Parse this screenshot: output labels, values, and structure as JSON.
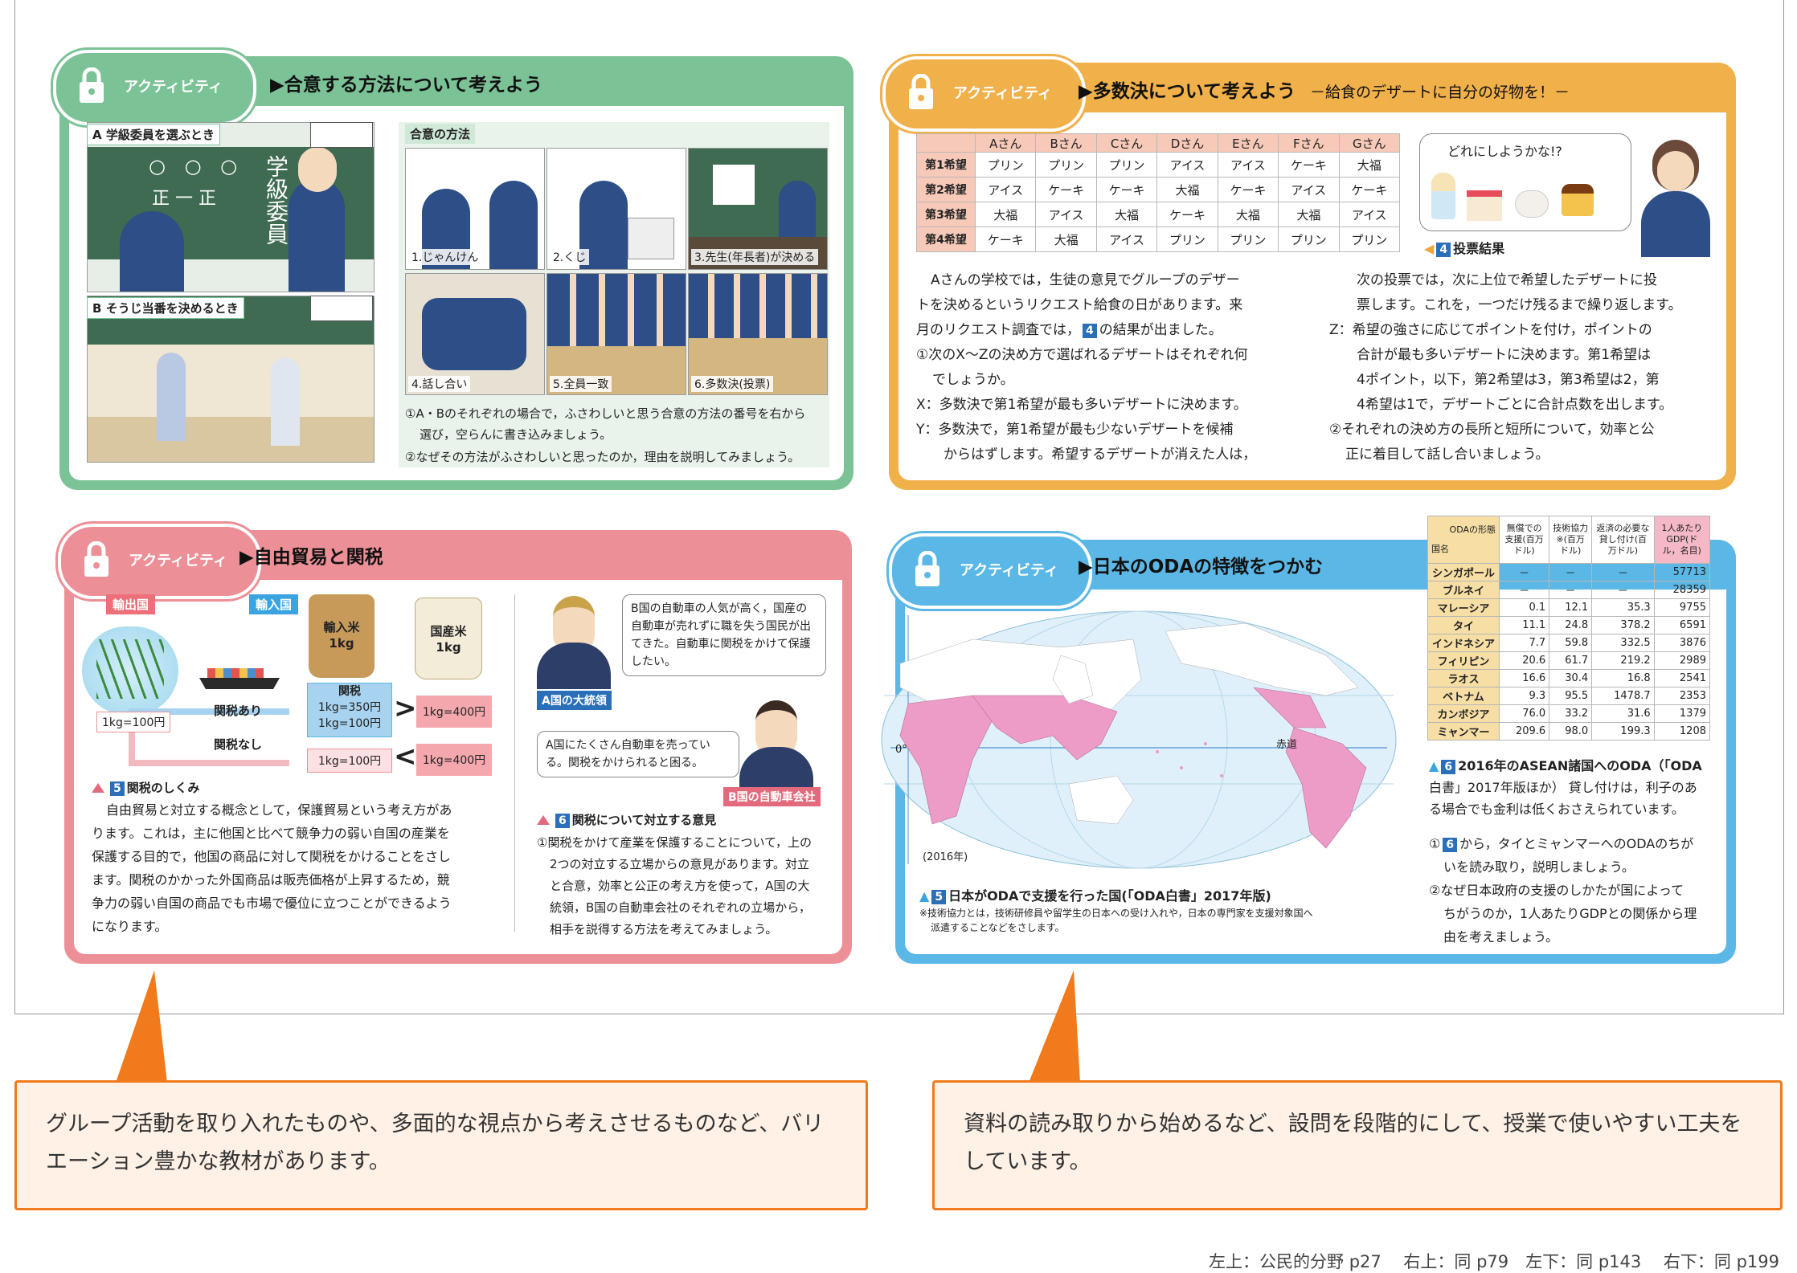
{
  "activity_label": "アクティビティ",
  "p1": {
    "title": "▶合意する方法について考えよう",
    "scene_a": "A 学級委員を選ぶとき",
    "scene_b": "B そうじ当番を決めるとき",
    "methods_label": "合意の方法",
    "board_text": "学級委員",
    "board_marks": "○ ○ ○",
    "board_tally": "正 一   正",
    "methods": [
      "1.じゃんけん",
      "2.くじ",
      "3.先生(年長者)が決める",
      "4.話し合い",
      "5.全員一致",
      "6.多数決(投票)"
    ],
    "q1": "①A・Bのそれぞれの場合で，ふさわしいと思う合意の方法の番号を右から",
    "q1b": "選び，空らんに書き込みましょう。",
    "q2": "②なぜその方法がふさわしいと思ったのか，理由を説明してみましょう。"
  },
  "p2": {
    "title": "▶多数決について考えよう",
    "subtitle": "－給食のデザートに自分の好物を！－",
    "table_headers": [
      "Aさん",
      "Bさん",
      "Cさん",
      "Dさん",
      "Eさん",
      "Fさん",
      "Gさん"
    ],
    "table_rows": [
      {
        "label": "第1希望",
        "cells": [
          "プリン",
          "プリン",
          "プリン",
          "アイス",
          "アイス",
          "ケーキ",
          "大福"
        ]
      },
      {
        "label": "第2希望",
        "cells": [
          "アイス",
          "ケーキ",
          "ケーキ",
          "大福",
          "ケーキ",
          "アイス",
          "ケーキ"
        ]
      },
      {
        "label": "第3希望",
        "cells": [
          "大福",
          "アイス",
          "大福",
          "ケーキ",
          "大福",
          "大福",
          "アイス"
        ]
      },
      {
        "label": "第4希望",
        "cells": [
          "ケーキ",
          "大福",
          "アイス",
          "プリン",
          "プリン",
          "プリン",
          "プリン"
        ]
      }
    ],
    "bubble": "どれにしようかな!?",
    "fig_num": "4",
    "fig_label": "投票結果",
    "left_lines": [
      "Aさんの学校では，生徒の意見でグループのデザー",
      "トを決めるというリクエスト給食の日があります。来",
      "月のリクエスト調査では，",
      "①次のX～Zの決め方で選ばれるデザートはそれぞれ何",
      "でしょうか。",
      "X：多数決で第1希望が最も多いデザートに決めます。",
      "Y：多数決で，第1希望が最も少ないデザートを候補",
      "からはずします。希望するデザートが消えた人は，"
    ],
    "line3_tail": "の結果が出ました。",
    "right_lines": [
      "次の投票では，次に上位で希望したデザートに投",
      "票します。これを，一つだけ残るまで繰り返します。",
      "Z：希望の強さに応じてポイントを付け，ポイントの",
      "合計が最も多いデザートに決めます。第1希望は",
      "4ポイント，以下，第2希望は3，第3希望は2，第",
      "4希望は1で，デザートごとに合計点数を出します。",
      "②それぞれの決め方の長所と短所について，効率と公",
      "正に着目して話し合いましょう。"
    ]
  },
  "p3": {
    "title": "▶自由貿易と関税",
    "export_label": "輸出国",
    "import_label": "輸入国",
    "import_rice": "輸入米",
    "import_rice_w": "1kg",
    "domestic_rice": "国産米",
    "domestic_rice_w": "1kg",
    "price_origin": "1kg=100円",
    "tariff_yes": "関税あり",
    "tariff_no": "関税なし",
    "tariff_box_title": "関税",
    "tariff_box_1": "1kg=350円",
    "tariff_box_2": "1kg=100円",
    "price_no_tariff": "1kg=100円",
    "domestic_price_1": "1kg=400円",
    "domestic_price_2": "1kg=400円",
    "fig5_num": "5",
    "fig5_label": "関税のしくみ",
    "body_lines": [
      "自由貿易と対立する概念として，保護貿易という考え方があ",
      "ります。これは，主に他国と比べて競争力の弱い自国の産業を",
      "保護する目的で，他国の商品に対して関税をかけることをさし",
      "ます。関税のかかった外国商品は販売価格が上昇するため，競",
      "争力の弱い自国の商品でも市場で優位に立つことができるよう",
      "になります。"
    ],
    "bubble_a": "B国の自動車の人気が高く，国産の自動車が売れずに職を失う国民が出てきた。自動車に関税をかけて保護したい。",
    "label_a": "A国の大統領",
    "bubble_b": "A国にたくさん自動車を売っている。関税をかけられると困る。",
    "label_b": "B国の自動車会社",
    "fig6_num": "6",
    "fig6_label": "関税について対立する意見",
    "q_lines": [
      "①関税をかけて産業を保護することについて，上の",
      "2つの対立する立場からの意見があります。対立",
      "と合意，効率と公正の考え方を使って，A国の大",
      "統領，B国の自動車会社のそれぞれの立場から，",
      "相手を説得する方法を考えてみましょう。"
    ]
  },
  "p4": {
    "title": "▶日本のODAの特徴をつかむ",
    "map_year": "(2016年)",
    "equator": "赤道",
    "meridian": "0°",
    "fig5_num": "5",
    "fig5_label": "日本がODAで支援を行った国(「ODA白書」2017年版)",
    "note1": "※技術協力とは，技術研修員や留学生の日本への受け入れや，日本の専門家を支援対象国へ",
    "note2": "派遣することなどをさします。",
    "table_header_corner_top": "ODAの形態",
    "table_header_corner_bottom": "国名",
    "table_headers": [
      "無償での支援(百万ドル)",
      "技術協力※(百万ドル)",
      "返済の必要な貸し付け(百万ドル)",
      "1人あたりGDP(ドル，名目)"
    ],
    "table_rows": [
      {
        "country": "シンガポール",
        "v": [
          "－",
          "－",
          "－",
          "57713"
        ]
      },
      {
        "country": "ブルネイ",
        "v": [
          "－",
          "－",
          "－",
          "28359"
        ]
      },
      {
        "country": "マレーシア",
        "v": [
          "0.1",
          "12.1",
          "35.3",
          "9755"
        ]
      },
      {
        "country": "タイ",
        "v": [
          "11.1",
          "24.8",
          "378.2",
          "6591"
        ]
      },
      {
        "country": "インドネシア",
        "v": [
          "7.7",
          "59.8",
          "332.5",
          "3876"
        ]
      },
      {
        "country": "フィリピン",
        "v": [
          "20.6",
          "61.7",
          "219.2",
          "2989"
        ]
      },
      {
        "country": "ラオス",
        "v": [
          "16.6",
          "30.4",
          "16.8",
          "2541"
        ]
      },
      {
        "country": "ベトナム",
        "v": [
          "9.3",
          "95.5",
          "1478.7",
          "2353"
        ]
      },
      {
        "country": "カンボジア",
        "v": [
          "76.0",
          "33.2",
          "31.6",
          "1379"
        ]
      },
      {
        "country": "ミャンマー",
        "v": [
          "209.6",
          "98.0",
          "199.3",
          "1208"
        ]
      }
    ],
    "fig6_num": "6",
    "cap_lines": [
      "2016年のASEAN諸国へのODA（「ODA",
      "白書」2017年版ほか） 貸し付けは，利子のあ",
      "る場合でも金利は低くおさえられています。"
    ],
    "q_lines": [
      "①",
      "から，タイとミャンマーへのODAのちが",
      "いを読み取り，説明しましょう。",
      "②なぜ日本政府の支援のしかたが国によって",
      "ちがうのか，1人あたりGDPとの関係から理",
      "由を考えましょう。"
    ]
  },
  "callouts": {
    "left": "グループ活動を取り入れたものや、多面的な視点から考えさせるものなど、バリエーション豊かな教材があります。",
    "right": "資料の読み取りから始めるなど、設問を段階的にして、授業で使いやすい工夫をしています。"
  },
  "footer": "左上：公民的分野 p27　 右上：同 p79　左下：同 p143　 右下：同 p199",
  "colors": {
    "green": "#7cc297",
    "orange": "#f0b04a",
    "pink": "#ec8f96",
    "blue": "#5bb8e6",
    "callout_border": "#f07a1c",
    "callout_bg": "#fff1e6"
  }
}
